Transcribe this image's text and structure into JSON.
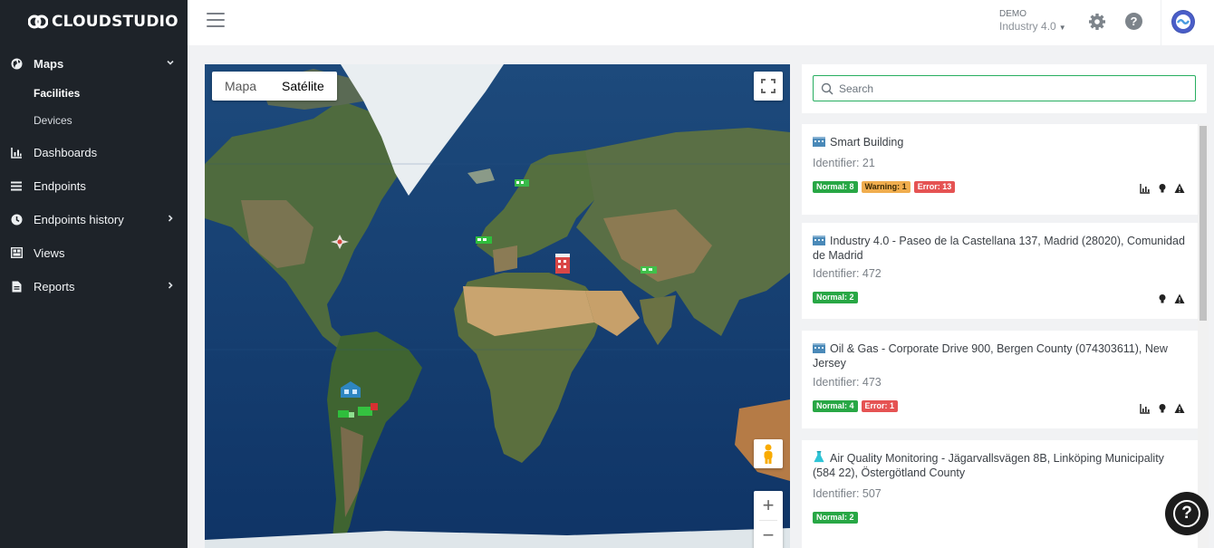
{
  "brand": {
    "name": "CLOUDSTUDIO"
  },
  "sidebar": {
    "items": [
      {
        "label": "Maps",
        "icon": "globe-icon"
      },
      {
        "label": "Facilities"
      },
      {
        "label": "Devices"
      },
      {
        "label": "Dashboards",
        "icon": "chart-icon"
      },
      {
        "label": "Endpoints",
        "icon": "list-icon"
      },
      {
        "label": "Endpoints history",
        "icon": "clock-icon"
      },
      {
        "label": "Views",
        "icon": "views-icon"
      },
      {
        "label": "Reports",
        "icon": "file-icon"
      }
    ]
  },
  "topbar": {
    "org_label": "DEMO",
    "org_name": "Industry 4.0"
  },
  "help_icon_glyph": "?",
  "map": {
    "type_options": [
      "Mapa",
      "Satélite"
    ],
    "selected_type": "Satélite",
    "zoom_in": "+",
    "zoom_out": "−"
  },
  "search": {
    "placeholder": "Search"
  },
  "facilities": [
    {
      "title": "Smart Building",
      "identifier": "Identifier: 21",
      "badges": [
        "Normal: 8",
        "Warning: 1",
        "Error: 13"
      ]
    },
    {
      "title": "Industry 4.0 - Paseo de la Castellana 137, Madrid (28020), Comunidad de Madrid",
      "identifier": "Identifier: 472",
      "badges": [
        "Normal: 2"
      ]
    },
    {
      "title": "Oil & Gas - Corporate Drive 900, Bergen County (074303611), New Jersey",
      "identifier": "Identifier: 473",
      "badges": [
        "Normal: 4",
        "Error: 1"
      ]
    },
    {
      "title": "Air Quality Monitoring - Jägarvallsvägen 8B, Linköping Municipality (584 22), Östergötland County",
      "identifier": "Identifier: 507",
      "badges": [
        "Normal: 2"
      ]
    }
  ],
  "colors": {
    "sidebar": "#1e2329",
    "normal": "#28a745",
    "warning": "#f0ad4e",
    "error": "#e55353",
    "search_border": "#27ae60"
  }
}
